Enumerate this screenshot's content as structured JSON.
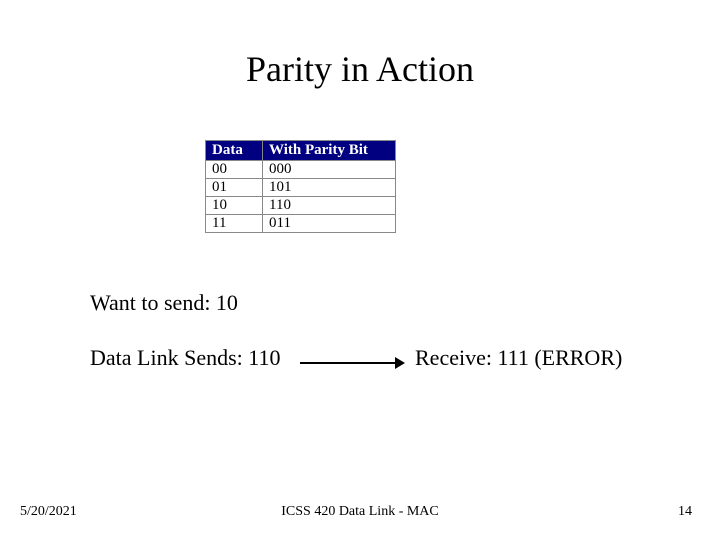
{
  "title": "Parity in Action",
  "table": {
    "headers": [
      "Data",
      "With Parity Bit"
    ],
    "rows": [
      [
        "00",
        "000"
      ],
      [
        "01",
        "101"
      ],
      [
        "10",
        "110"
      ],
      [
        "11",
        "011"
      ]
    ]
  },
  "want_to_send": "Want to send:  10",
  "data_link_sends": "Data Link Sends:  110",
  "receive": "Receive:  111 (ERROR)",
  "footer": {
    "date": "5/20/2021",
    "center": "ICSS 420 Data Link - MAC",
    "page": "14"
  }
}
